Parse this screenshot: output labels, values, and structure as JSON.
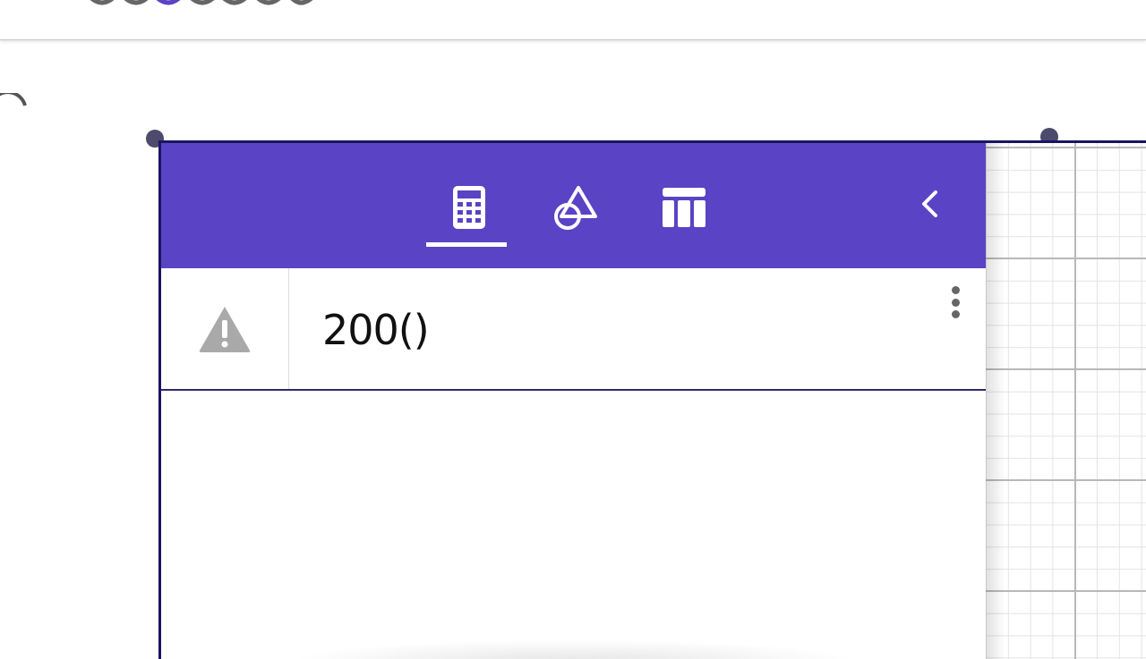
{
  "header": {
    "tabs": [
      {
        "id": "algebra",
        "icon": "calculator-icon",
        "selected": true
      },
      {
        "id": "tools",
        "icon": "shapes-icon",
        "selected": false
      },
      {
        "id": "table",
        "icon": "table-icon",
        "selected": false
      }
    ],
    "collapse_icon": "chevron-left-icon",
    "background": "#5a43c4"
  },
  "algebra_row": {
    "status_icon": "warning-icon",
    "expression": "200()",
    "menu_icon": "more-vert-icon"
  },
  "colors": {
    "accent": "#5a43c4",
    "border": "#1b1464",
    "warning_icon": "#a9a9a9"
  }
}
